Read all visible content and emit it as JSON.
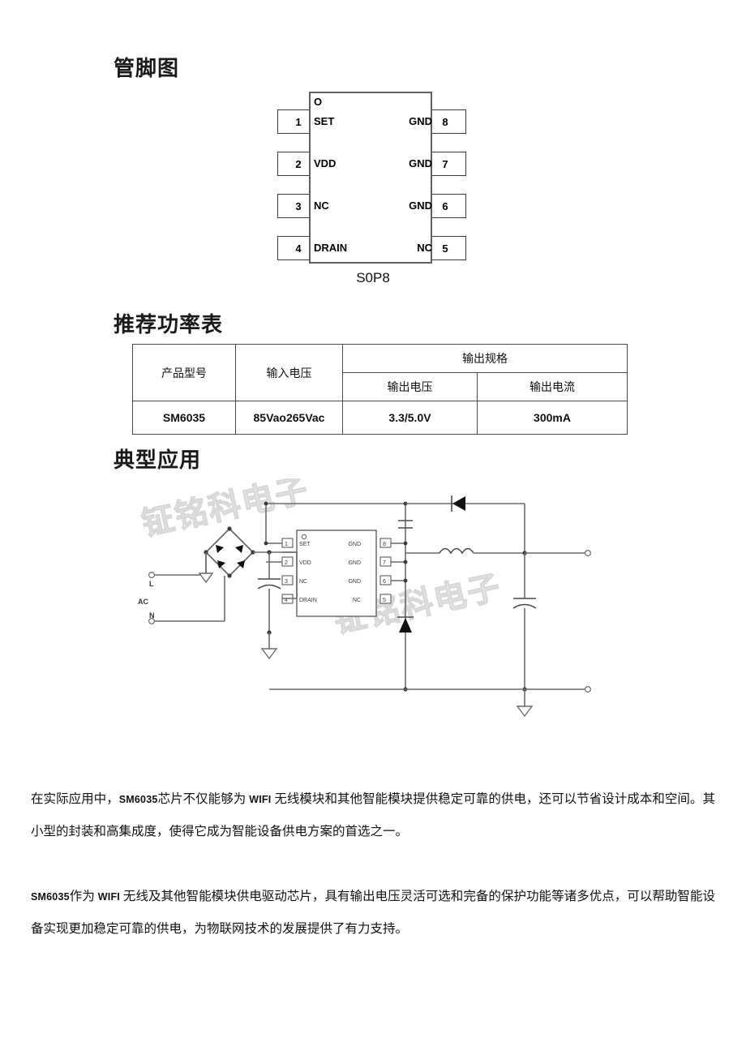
{
  "headings": {
    "pinout": "管脚图",
    "power_table": "推荐功率表",
    "application": "典型应用"
  },
  "pinout": {
    "package_name": "S0P8",
    "orientation_marker": "O",
    "pins_left": [
      {
        "number": "1",
        "label": "SET"
      },
      {
        "number": "2",
        "label": "VDD"
      },
      {
        "number": "3",
        "label": "NC"
      },
      {
        "number": "4",
        "label": "DRAIN"
      }
    ],
    "pins_right": [
      {
        "number": "8",
        "label": "GND"
      },
      {
        "number": "7",
        "label": "GND"
      },
      {
        "number": "6",
        "label": "GND"
      },
      {
        "number": "5",
        "label": "NC"
      }
    ]
  },
  "power_table": {
    "headers": {
      "product_model": "产品型号",
      "input_voltage": "输入电压",
      "output_spec": "输出规格",
      "output_voltage": "输出电压",
      "output_current": "输出电流"
    },
    "rows": [
      {
        "product_model": "SM6035",
        "input_voltage": "85Vao265Vac",
        "output_voltage": "3.3/5.0V",
        "output_current": "300mA"
      }
    ]
  },
  "application_circuit": {
    "watermarks": [
      "钲铭科电子",
      "钲铭科电子"
    ],
    "ac_label": "AC",
    "line_label": "L",
    "neutral_label": "N",
    "ic_orientation_marker": "O",
    "ic_pins_left": [
      {
        "number": "1",
        "label": "SET"
      },
      {
        "number": "2",
        "label": "VDD"
      },
      {
        "number": "3",
        "label": "NC"
      },
      {
        "number": "4",
        "label": "DRAIN"
      }
    ],
    "ic_pins_right": [
      {
        "number": "8",
        "label": "GND"
      },
      {
        "number": "7",
        "label": "GND"
      },
      {
        "number": "6",
        "label": "GND"
      },
      {
        "number": "5",
        "label": "NC"
      }
    ]
  },
  "paragraphs": {
    "p1_a": "在实际应用中，",
    "p1_kw1": "SM6035",
    "p1_b": "芯片不仅能够为",
    "p1_kw2": "WIFI",
    "p1_c": "无线模块和其他智能模块提供稳定可靠的供电，还可以节省设计成本和空间。其小型的封装和高集成度，使得它成为智能设备供电方案的首选之一。",
    "p2_kw1": "SM6035",
    "p2_a": "作为",
    "p2_kw2": "WIFI",
    "p2_b": "无线及其他智能模块供电驱动芯片，具有输出电压灵活可选和完备的保护功能等诸多优点，可以帮助智能设备实现更加稳定可靠的供电，为物联网技术的发展提供了有力支持。"
  },
  "colors": {
    "text": "#111111",
    "wire": "#6b6b6b",
    "ic_border": "#5f5f5f",
    "table_border": "#4a4a4a",
    "watermark": "#d9d9d9"
  }
}
